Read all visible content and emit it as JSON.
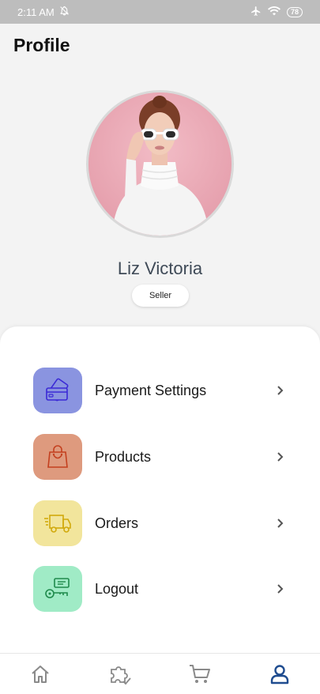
{
  "status_bar": {
    "time": "2:11 AM",
    "battery": "78",
    "icons": [
      "notifications-off-icon",
      "airplane-mode-icon",
      "wifi-icon",
      "battery-icon"
    ]
  },
  "header": {
    "title": "Profile"
  },
  "profile": {
    "name": "Liz Victoria",
    "role": "Seller",
    "avatar_icon": "profile-photo"
  },
  "menu": {
    "items": [
      {
        "label": "Payment Settings",
        "icon": "payment-card-icon",
        "color": "#8a94e0"
      },
      {
        "label": "Products",
        "icon": "shopping-bag-icon",
        "color": "#de9a7e"
      },
      {
        "label": "Orders",
        "icon": "delivery-truck-icon",
        "color": "#f2e59c"
      },
      {
        "label": "Logout",
        "icon": "key-icon",
        "color": "#a0ebc6"
      }
    ]
  },
  "bottom_nav": {
    "items": [
      {
        "icon": "home-icon"
      },
      {
        "icon": "puzzle-icon"
      },
      {
        "icon": "cart-icon"
      },
      {
        "icon": "user-icon",
        "active": true
      }
    ],
    "active_color": "#1f4c8f",
    "inactive_color": "#8a8a8a"
  }
}
